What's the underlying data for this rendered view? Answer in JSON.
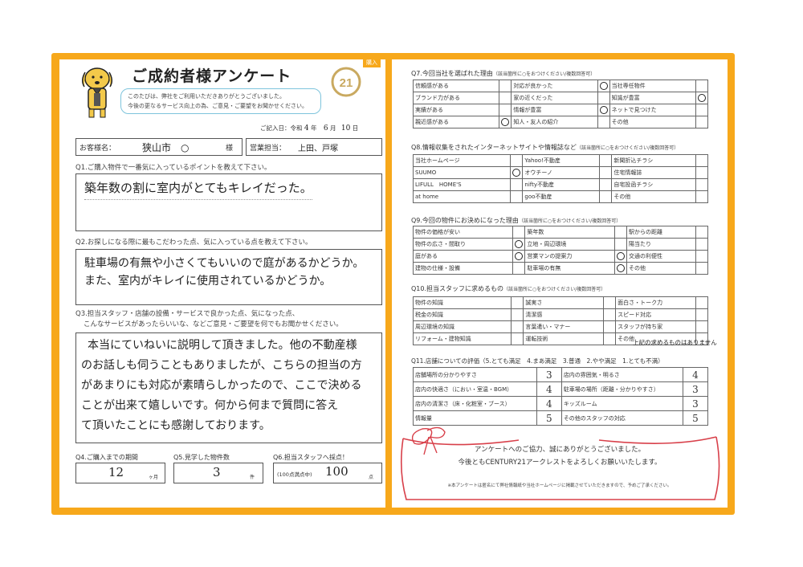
{
  "header": {
    "tag": "購入",
    "title": "ご成約者様アンケート",
    "greeting_lines": [
      "このたびは、弊社をご利用いただきありがとうございました。",
      "今後の更なるサービス向上の為、ご意見・ご要望をお聞かせください。"
    ],
    "date_label": "ご記入日：令和",
    "date_year": "4",
    "date_year_unit": "年",
    "date_month": "6",
    "date_month_unit": "月",
    "date_day": "10",
    "date_day_unit": "日",
    "logo_text": "21"
  },
  "customer": {
    "label": "お客様名：",
    "name": "狭山市　○",
    "suffix": "様",
    "staff_label": "営業担当：",
    "staff": "上田、戸塚"
  },
  "q1": {
    "question": "Q1.ご購入物件で一番気に入っているポイントを教えて下さい。",
    "answer": "築年数の割に室内がとてもキレイだった。"
  },
  "q2": {
    "question": "Q2.お探しになる際に最もこだわった点、気に入っている点を教えて下さい。",
    "answer_lines": [
      "駐車場の有無や小さくてもいいので庭があるかどうか。",
      "また、室内がキレイに使用されているかどうか。"
    ]
  },
  "q3": {
    "question_lines": [
      "Q3.担当スタッフ・店舗の設備・サービスで良かった点、気になった点、",
      "こんなサービスがあったらいいな、などご意見・ご要望を何でもお聞かせください。"
    ],
    "answer_lines": [
      "本当にていねいに説明して頂きました。他の不動産様",
      "のお話しも伺うこともありましたが、こちらの担当の方",
      "があまりにも対応が素晴らしかったので、ここで決める",
      "ことが出来て嬉しいです。何から何まで質問に答え",
      "て頂いたことにも感謝しております。"
    ]
  },
  "q4": {
    "label": "Q4.ご購入までの期間",
    "value": "12",
    "unit": "ヶ月"
  },
  "q5": {
    "label": "Q5.見学した物件数",
    "value": "3",
    "unit": "件"
  },
  "q6": {
    "label": "Q6.担当スタッフへ採点！",
    "sub": "(100点満点中)",
    "value": "100",
    "unit": "点"
  },
  "q7": {
    "title": "Q7.今回当社を選ばれた理由",
    "note": "（該当箇所に○をおつけください/複数回答可）",
    "rows": [
      [
        {
          "t": "信頼感がある",
          "c": false
        },
        {
          "t": "対応が良かった",
          "c": true
        },
        {
          "t": "当社専任物件",
          "c": false
        }
      ],
      [
        {
          "t": "ブランド力がある",
          "c": false
        },
        {
          "t": "家の近くだった",
          "c": false
        },
        {
          "t": "知識が豊富",
          "c": true
        }
      ],
      [
        {
          "t": "実績がある",
          "c": false
        },
        {
          "t": "情報が豊富",
          "c": true
        },
        {
          "t": "ネットで見つけた",
          "c": false
        }
      ],
      [
        {
          "t": "親近感がある",
          "c": true
        },
        {
          "t": "知人・友人の紹介",
          "c": false
        },
        {
          "t": "その他",
          "c": false
        }
      ]
    ]
  },
  "q8": {
    "title": "Q8.情報収集をされたインターネットサイトや情報誌など",
    "note": "（該当箇所に○をおつけください/複数回答可）",
    "rows": [
      [
        {
          "t": "当社ホームページ",
          "c": false
        },
        {
          "t": "Yahoo!不動産",
          "c": false
        },
        {
          "t": "新聞折込チラシ",
          "c": false
        }
      ],
      [
        {
          "t": "SUUMO",
          "c": true
        },
        {
          "t": "オウチーノ",
          "c": false
        },
        {
          "t": "住宅情報誌",
          "c": false
        }
      ],
      [
        {
          "t": "LIFULL　HOME'S",
          "c": false
        },
        {
          "t": "nifty不動産",
          "c": false
        },
        {
          "t": "自宅投函チラシ",
          "c": false
        }
      ],
      [
        {
          "t": "at home",
          "c": false
        },
        {
          "t": "goo不動産",
          "c": false
        },
        {
          "t": "その他",
          "c": false
        }
      ]
    ]
  },
  "q9": {
    "title": "Q9.今回の物件にお決めになった理由",
    "note": "（該当箇所に○をおつけください/複数回答可）",
    "rows": [
      [
        {
          "t": "物件の価格が安い",
          "c": false
        },
        {
          "t": "築年数",
          "c": false
        },
        {
          "t": "駅からの距離",
          "c": false
        }
      ],
      [
        {
          "t": "物件の広さ・間取り",
          "c": true
        },
        {
          "t": "立地・周辺環境",
          "c": false
        },
        {
          "t": "陽当たり",
          "c": false
        }
      ],
      [
        {
          "t": "庭がある",
          "c": true
        },
        {
          "t": "営業マンの提案力",
          "c": true
        },
        {
          "t": "交通の利便性",
          "c": false
        }
      ],
      [
        {
          "t": "建物の仕様・設備",
          "c": false
        },
        {
          "t": "駐車場の有無",
          "c": true
        },
        {
          "t": "その他",
          "c": false
        }
      ]
    ]
  },
  "q10": {
    "title": "Q10.担当スタッフに求めるもの",
    "note": "（該当箇所に○をおつけください/複数回答可）",
    "rows": [
      [
        {
          "t": "物件の知識",
          "c": false
        },
        {
          "t": "誠実さ",
          "c": false
        },
        {
          "t": "面白さ・トーク力",
          "c": false
        }
      ],
      [
        {
          "t": "税金の知識",
          "c": false
        },
        {
          "t": "清潔感",
          "c": false
        },
        {
          "t": "スピード対応",
          "c": false
        }
      ],
      [
        {
          "t": "周辺環境の知識",
          "c": false
        },
        {
          "t": "言葉遣い・マナー",
          "c": false
        },
        {
          "t": "スタッフが持ち家",
          "c": false
        }
      ],
      [
        {
          "t": "リフォーム・建物知識",
          "c": false
        },
        {
          "t": "運転技術",
          "c": false
        },
        {
          "t": "その他",
          "c": false
        }
      ]
    ],
    "other_text": "上記の求めるものはありません"
  },
  "q11": {
    "title": "Q11.店舗についての評価（5.とても満足　4.まあ満足　3.普通　2.やや満足　1.とても不満）",
    "rows": [
      [
        {
          "t": "店舗場所の分かりやすさ",
          "s": "3"
        },
        {
          "t": "店内の雰囲気・明るさ",
          "s": "4"
        }
      ],
      [
        {
          "t": "店内の快適さ（におい・室温・BGM）",
          "s": "4"
        },
        {
          "t": "駐車場の場所（距離・分かりやすさ）",
          "s": "3"
        }
      ],
      [
        {
          "t": "店内の清潔さ（床・化粧室・ブース）",
          "s": "4"
        },
        {
          "t": "キッズルーム",
          "s": "3"
        }
      ],
      [
        {
          "t": "情報量",
          "s": "5"
        },
        {
          "t": "その他のスタッフの対応",
          "s": "5"
        }
      ]
    ]
  },
  "thanks": {
    "line1": "アンケートへのご協力、誠にありがとうございました。",
    "line2": "今後ともCENTURY21アークレストをよろしくお願いいたします。",
    "footnote": "※本アンケートは匿名にて弊社情報紙や当社ホームページに掲載させていただきますので、予めご了承ください。"
  },
  "colors": {
    "frame": "#f7a81b",
    "logo": "#c9a960",
    "ribbon": "#d8404a",
    "bubble": "#7ec4dc"
  }
}
